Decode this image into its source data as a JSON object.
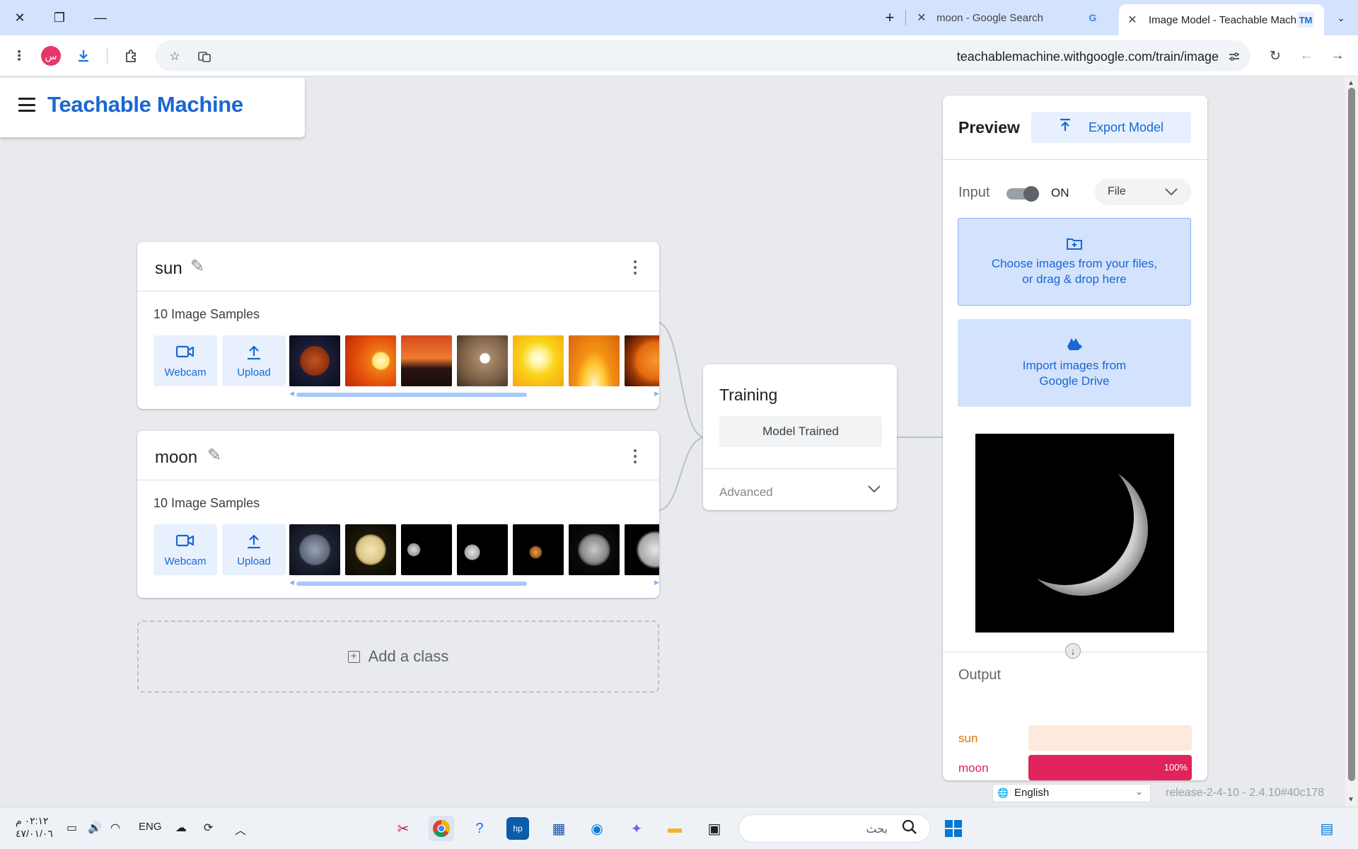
{
  "browser": {
    "tabs": [
      {
        "title": "moon - Google Search",
        "favicon": "G"
      },
      {
        "title": "Image Model - Teachable Mach",
        "favicon": "TM"
      }
    ],
    "url": "teachablemachine.withgoogle.com/train/image",
    "profile_initial": "س"
  },
  "app": {
    "brand": "Teachable Machine"
  },
  "classes": [
    {
      "name": "sun",
      "samples_label": "10 Image Samples",
      "webcam_label": "Webcam",
      "upload_label": "Upload",
      "thumbs": [
        "radial-gradient(circle at 50% 50%, #c4541c 0%, #8a2e10 40%, #1a1e38 42%, #0a0c1c 100%)",
        "radial-gradient(circle at 70% 50%, #fff7d0 0%, #ffe56b 18%, #f07c18 22%, #e2490b 60%, #b8290a 100%)",
        "linear-gradient(180deg,#d44a1c 0%,#f07a30 45%,#2b1410 65%,#1a0c08 100%)",
        "radial-gradient(circle at 55% 45%, #fff 0%, #fff 12%, #a98a6b 14%, #7a5e45 60%, #3b2e24 100%)",
        "radial-gradient(circle at 50% 45%, #fffef0 0%, #fff59d 20%, #fbd31a 45%, #f5a70f 100%)",
        "radial-gradient(ellipse at 50% 100%, #fff7cc 0%, #ffc933 30%, #f39013 50%, #d9640e 100%)",
        "radial-gradient(circle at 60% 50%, #f79a2d 0%, #e36a0f 45%, #a13a06 60%, #2a0c00 100%)"
      ]
    },
    {
      "name": "moon",
      "samples_label": "10 Image Samples",
      "webcam_label": "Webcam",
      "upload_label": "Upload",
      "thumbs": [
        "radial-gradient(circle at 50% 50%, #9aa4b4 0%, #5d6678 40%, #1d2231 45%, #0c0f18 100%)",
        "radial-gradient(circle at 50% 50%, #f5e6b3 0%, #d9c78a 35%, #b59f61 40%, #1a1608 44%, #0a0804 100%)",
        "radial-gradient(circle at 25% 50%, #dcdcdc 0%, #9b9b9b 13%, #000 15%), radial-gradient(circle at 75% 50%, #dcdcdc 0%, #9b9b9b 13%, #000 15%)",
        "radial-gradient(circle at 30% 55%, #e4e4e4 0%, #a8a8a8 16%, #000 18%, #000 100%)",
        "radial-gradient(circle at 45% 55%, #e9a04c 0%, #a05a1e 14%, #000 17%, #000 100%)",
        "radial-gradient(circle at 50% 50%, #c9c9c9 0%, #8a8a8a 35%, #5b5b5b 42%, #0b0b0b 46%, #000 100%)",
        "radial-gradient(circle at 60% 50%, #e6e6e6 0%, #a6a6a6 40%, #000 48%, #000 100%)"
      ]
    }
  ],
  "add_class_label": "Add a class",
  "training": {
    "title": "Training",
    "status_button": "Model Trained",
    "advanced_label": "Advanced"
  },
  "preview": {
    "title": "Preview",
    "export_label": "Export Model",
    "input_label": "Input",
    "toggle_state": "ON",
    "source_value": "File",
    "drop_line1": "Choose images from your files,",
    "drop_line2": "or drag & drop here",
    "drive_line1": "Import images from",
    "drive_line2": "Google Drive",
    "output_label": "Output",
    "outputs": [
      {
        "name": "sun",
        "percent": 0,
        "percent_label": "",
        "color": "#e37400",
        "bg": "#fde9dd"
      },
      {
        "name": "moon",
        "percent": 100,
        "percent_label": "100%",
        "color": "#e0235a",
        "bg": "#fbd4de"
      }
    ]
  },
  "footer": {
    "language": "English",
    "release": "release-2-4-10 - 2.4.10#40c178"
  },
  "taskbar": {
    "time": "٠٢:١٢ م",
    "date": "٤٧/٠١/٠٦",
    "lang": "ENG",
    "search_placeholder": "بحث"
  },
  "colors": {
    "accent": "#1967d2",
    "accent_bg": "#e8f0fe",
    "tab_strip": "#d3e3fd"
  }
}
